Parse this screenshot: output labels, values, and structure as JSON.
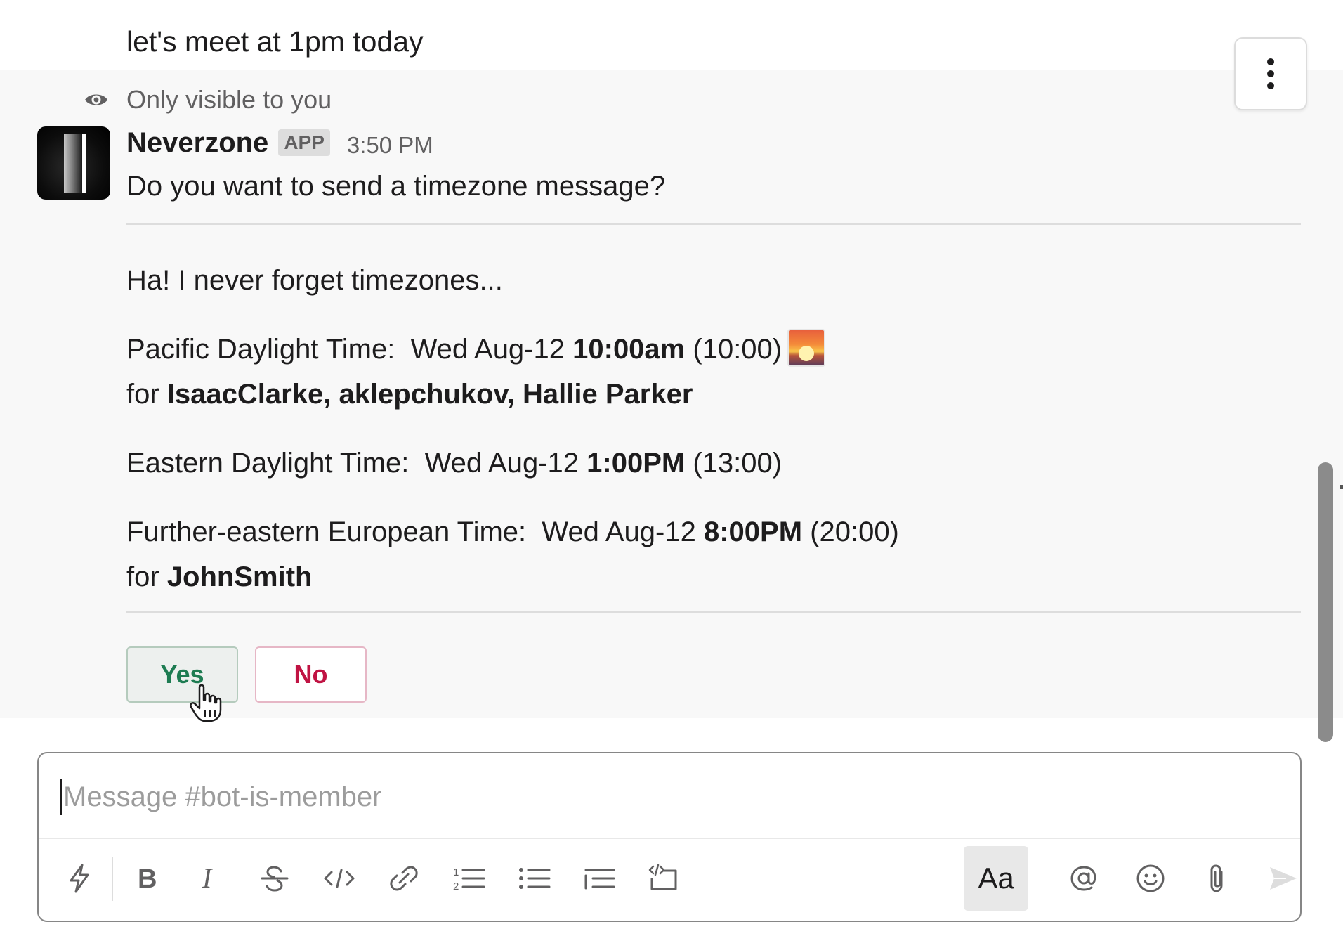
{
  "previous_message": {
    "text": "let's meet at 1pm today"
  },
  "ephemeral_notice": {
    "icon": "eye-icon",
    "text": "Only visible to you"
  },
  "message": {
    "sender": "Neverzone",
    "badge": "APP",
    "time": "3:50 PM",
    "question": "Do you want to send a timezone message?",
    "intro": "Ha! I never forget timezones...",
    "timezones": [
      {
        "zone": "Pacific Daylight Time:",
        "date": "Wed Aug-12",
        "time_bold": "10:00am",
        "time_24": "(10:00)",
        "icon": "sunrise-icon",
        "for_label": "for",
        "users": "IsaacClarke, aklepchukov, Hallie Parker"
      },
      {
        "zone": "Eastern Daylight Time:",
        "date": "Wed Aug-12",
        "time_bold": "1:00PM",
        "time_24": "(13:00)"
      },
      {
        "zone": "Further-eastern European Time:",
        "date": "Wed Aug-12",
        "time_bold": "8:00PM",
        "time_24": "(20:00)",
        "for_label": "for",
        "users": "JohnSmith"
      }
    ],
    "actions": {
      "yes_label": "Yes",
      "no_label": "No"
    }
  },
  "composer": {
    "placeholder": "Message #bot-is-member",
    "toolbar_icons": [
      "shortcuts-icon",
      "bold-icon",
      "italic-icon",
      "strikethrough-icon",
      "code-icon",
      "link-icon",
      "ordered-list-icon",
      "bulleted-list-icon",
      "blockquote-icon",
      "code-block-icon",
      "formatting-icon",
      "mention-icon",
      "emoji-icon",
      "attach-icon",
      "send-icon"
    ],
    "format_label": "Aa"
  },
  "colors": {
    "yes": "#1e7c52",
    "no": "#c01343",
    "ephemeral_bg": "#f8f8f8"
  }
}
